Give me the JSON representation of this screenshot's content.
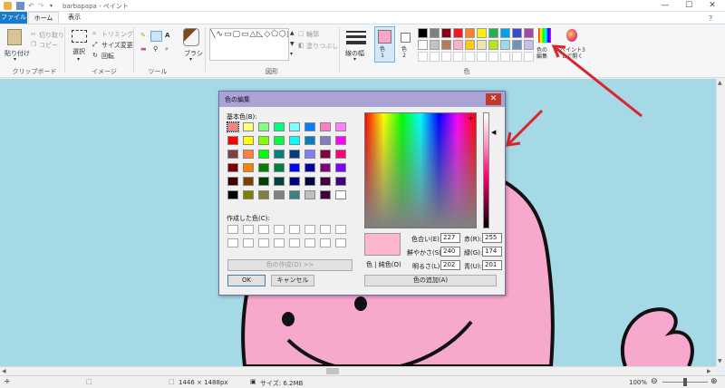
{
  "titlebar": {
    "title": "barbapapa - ペイント",
    "minimize": "—",
    "maximize": "☐",
    "close": "✕"
  },
  "tabs": {
    "file": "ファイル",
    "home": "ホーム",
    "view": "表示"
  },
  "ribbon": {
    "clipboard": {
      "paste": "貼り付け",
      "cut": "切り取り",
      "copy": "コピー",
      "label": "クリップボード"
    },
    "image": {
      "select": "選択",
      "crop": "トリミング",
      "resize": "サイズ変更",
      "rotate": "回転",
      "label": "イメージ"
    },
    "tools": {
      "label": "ツール"
    },
    "brushes": {
      "label": "ブラシ"
    },
    "shapes": {
      "outline": "輪郭",
      "fill": "塗りつぶし",
      "label": "図形"
    },
    "size": {
      "label": "線の幅"
    },
    "colors": {
      "color1": "色\n1",
      "color2": "色\n2",
      "edit": "色の\n編集",
      "paint3d": "ペイント3\nDで開く",
      "label": "色",
      "color1_value": "#f4a6cb",
      "color2_value": "#ffffff",
      "palette_row1": [
        "#000000",
        "#7f7f7f",
        "#880015",
        "#ed1c24",
        "#ff7f27",
        "#fff200",
        "#22b14c",
        "#00a2e8",
        "#3f48cc",
        "#a349a4"
      ],
      "palette_row2": [
        "#ffffff",
        "#c3c3c3",
        "#b97a57",
        "#ffaec9",
        "#ffc90e",
        "#efe4b0",
        "#b5e61d",
        "#99d9ea",
        "#7092be",
        "#c8bfe7"
      ]
    }
  },
  "dialog": {
    "title": "色の編集",
    "basic_colors_label": "基本色(B):",
    "basic_colors": [
      "#ff8080",
      "#ffff80",
      "#80ff80",
      "#00ff80",
      "#80ffff",
      "#0080ff",
      "#ff80c0",
      "#ff80ff",
      "#ff0000",
      "#ffff00",
      "#80ff00",
      "#00ff40",
      "#00ffff",
      "#0080c0",
      "#8080c0",
      "#ff00ff",
      "#804040",
      "#ff8040",
      "#00ff00",
      "#008080",
      "#004080",
      "#8080ff",
      "#800040",
      "#ff0080",
      "#800000",
      "#ff8000",
      "#008000",
      "#008040",
      "#0000ff",
      "#0000a0",
      "#800080",
      "#8000ff",
      "#400000",
      "#804000",
      "#004000",
      "#004040",
      "#000080",
      "#000040",
      "#400040",
      "#400080",
      "#000000",
      "#808000",
      "#808040",
      "#808080",
      "#408080",
      "#c0c0c0",
      "#400040",
      "#ffffff"
    ],
    "custom_colors_label": "作成した色(C):",
    "define_custom": "色の作成(D) >>",
    "ok": "OK",
    "cancel": "キャンセル",
    "preview_color": "#fdb6cb",
    "color_solid_label": "色 | 純色(O)",
    "hue_label": "色合い(E):",
    "hue": "227",
    "sat_label": "鮮やかさ(S):",
    "sat": "240",
    "lum_label": "明るさ(L):",
    "lum": "202",
    "red_label": "赤(R):",
    "red": "255",
    "green_label": "緑(G):",
    "green": "174",
    "blue_label": "青(U):",
    "blue": "201",
    "add_to_custom": "色の追加(A)"
  },
  "statusbar": {
    "dimensions": "1446 × 1488px",
    "size": "サイズ: 6.2MB",
    "zoom": "100%"
  },
  "annotation_color": "#d9262c"
}
